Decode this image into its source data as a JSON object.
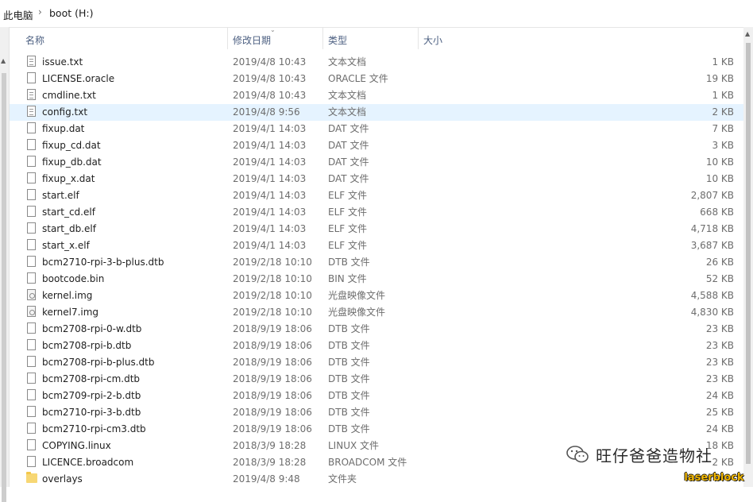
{
  "breadcrumb": {
    "root": "此电脑",
    "separator": "›",
    "current": "boot (H:)"
  },
  "columns": {
    "name": "名称",
    "date": "修改日期",
    "type": "类型",
    "size": "大小"
  },
  "files": [
    {
      "name": "issue.txt",
      "date": "2019/4/8 10:43",
      "type": "文本文档",
      "size": "1 KB",
      "icon": "text-file-icon"
    },
    {
      "name": "LICENSE.oracle",
      "date": "2019/4/8 10:43",
      "type": "ORACLE 文件",
      "size": "19 KB",
      "icon": "file-icon"
    },
    {
      "name": "cmdline.txt",
      "date": "2019/4/8 10:43",
      "type": "文本文档",
      "size": "1 KB",
      "icon": "text-file-icon"
    },
    {
      "name": "config.txt",
      "date": "2019/4/8 9:56",
      "type": "文本文档",
      "size": "2 KB",
      "icon": "text-file-icon",
      "selected": true
    },
    {
      "name": "fixup.dat",
      "date": "2019/4/1 14:03",
      "type": "DAT 文件",
      "size": "7 KB",
      "icon": "file-icon"
    },
    {
      "name": "fixup_cd.dat",
      "date": "2019/4/1 14:03",
      "type": "DAT 文件",
      "size": "3 KB",
      "icon": "file-icon"
    },
    {
      "name": "fixup_db.dat",
      "date": "2019/4/1 14:03",
      "type": "DAT 文件",
      "size": "10 KB",
      "icon": "file-icon"
    },
    {
      "name": "fixup_x.dat",
      "date": "2019/4/1 14:03",
      "type": "DAT 文件",
      "size": "10 KB",
      "icon": "file-icon"
    },
    {
      "name": "start.elf",
      "date": "2019/4/1 14:03",
      "type": "ELF 文件",
      "size": "2,807 KB",
      "icon": "file-icon"
    },
    {
      "name": "start_cd.elf",
      "date": "2019/4/1 14:03",
      "type": "ELF 文件",
      "size": "668 KB",
      "icon": "file-icon"
    },
    {
      "name": "start_db.elf",
      "date": "2019/4/1 14:03",
      "type": "ELF 文件",
      "size": "4,718 KB",
      "icon": "file-icon"
    },
    {
      "name": "start_x.elf",
      "date": "2019/4/1 14:03",
      "type": "ELF 文件",
      "size": "3,687 KB",
      "icon": "file-icon"
    },
    {
      "name": "bcm2710-rpi-3-b-plus.dtb",
      "date": "2019/2/18 10:10",
      "type": "DTB 文件",
      "size": "26 KB",
      "icon": "file-icon"
    },
    {
      "name": "bootcode.bin",
      "date": "2019/2/18 10:10",
      "type": "BIN 文件",
      "size": "52 KB",
      "icon": "file-icon"
    },
    {
      "name": "kernel.img",
      "date": "2019/2/18 10:10",
      "type": "光盘映像文件",
      "size": "4,588 KB",
      "icon": "disc-image-icon"
    },
    {
      "name": "kernel7.img",
      "date": "2019/2/18 10:10",
      "type": "光盘映像文件",
      "size": "4,830 KB",
      "icon": "disc-image-icon"
    },
    {
      "name": "bcm2708-rpi-0-w.dtb",
      "date": "2018/9/19 18:06",
      "type": "DTB 文件",
      "size": "23 KB",
      "icon": "file-icon"
    },
    {
      "name": "bcm2708-rpi-b.dtb",
      "date": "2018/9/19 18:06",
      "type": "DTB 文件",
      "size": "23 KB",
      "icon": "file-icon"
    },
    {
      "name": "bcm2708-rpi-b-plus.dtb",
      "date": "2018/9/19 18:06",
      "type": "DTB 文件",
      "size": "23 KB",
      "icon": "file-icon"
    },
    {
      "name": "bcm2708-rpi-cm.dtb",
      "date": "2018/9/19 18:06",
      "type": "DTB 文件",
      "size": "23 KB",
      "icon": "file-icon"
    },
    {
      "name": "bcm2709-rpi-2-b.dtb",
      "date": "2018/9/19 18:06",
      "type": "DTB 文件",
      "size": "24 KB",
      "icon": "file-icon"
    },
    {
      "name": "bcm2710-rpi-3-b.dtb",
      "date": "2018/9/19 18:06",
      "type": "DTB 文件",
      "size": "25 KB",
      "icon": "file-icon"
    },
    {
      "name": "bcm2710-rpi-cm3.dtb",
      "date": "2018/9/19 18:06",
      "type": "DTB 文件",
      "size": "24 KB",
      "icon": "file-icon"
    },
    {
      "name": "COPYING.linux",
      "date": "2018/3/9 18:28",
      "type": "LINUX 文件",
      "size": "18 KB",
      "icon": "file-icon"
    },
    {
      "name": "LICENCE.broadcom",
      "date": "2018/3/9 18:28",
      "type": "BROADCOM 文件",
      "size": "2 KB",
      "icon": "file-icon"
    },
    {
      "name": "overlays",
      "date": "2019/4/8 9:48",
      "type": "文件夹",
      "size": "",
      "icon": "folder-icon"
    }
  ],
  "watermark": {
    "text": "旺仔爸爸造物社",
    "tag": "laserblock"
  },
  "colors": {
    "selected_row": "#e5f3ff",
    "header_text": "#4d6082",
    "folder": "#f7d774",
    "tag": "#f2b700"
  }
}
